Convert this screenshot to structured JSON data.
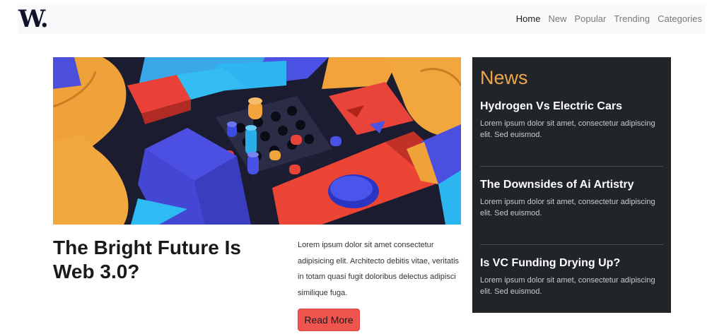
{
  "navbar": {
    "logo": "W.",
    "links": [
      {
        "label": "Home",
        "active": true
      },
      {
        "label": "New",
        "active": false
      },
      {
        "label": "Popular",
        "active": false
      },
      {
        "label": "Trending",
        "active": false
      },
      {
        "label": "Categories",
        "active": false
      }
    ]
  },
  "main": {
    "headline": "The Bright Future Is Web 3.0?",
    "excerpt": "Lorem ipsum dolor sit amet consectetur adipisicing elit. Architecto debitis vitae, veritatis in totam quasi fugit doloribus delectus adipisci similique fuga.",
    "read_more": "Read More",
    "image_colors": {
      "bg": "#1b1c30",
      "orange": "#f0a23a",
      "blue": "#4a4ee0",
      "red": "#ee4a3c",
      "cyan": "#2bb6f0"
    }
  },
  "sidebar": {
    "title": "News",
    "title_color": "#f0a54a",
    "bg_color": "#212529",
    "items": [
      {
        "title": "Hydrogen Vs Electric Cars",
        "text": "Lorem ipsum dolor sit amet, consectetur adipiscing elit. Sed euismod."
      },
      {
        "title": "The Downsides of Ai Artistry",
        "text": "Lorem ipsum dolor sit amet, consectetur adipiscing elit. Sed euismod."
      },
      {
        "title": "Is VC Funding Drying Up?",
        "text": "Lorem ipsum dolor sit amet, consectetur adipiscing elit. Sed euismod."
      }
    ]
  },
  "accent": "#f0544f"
}
